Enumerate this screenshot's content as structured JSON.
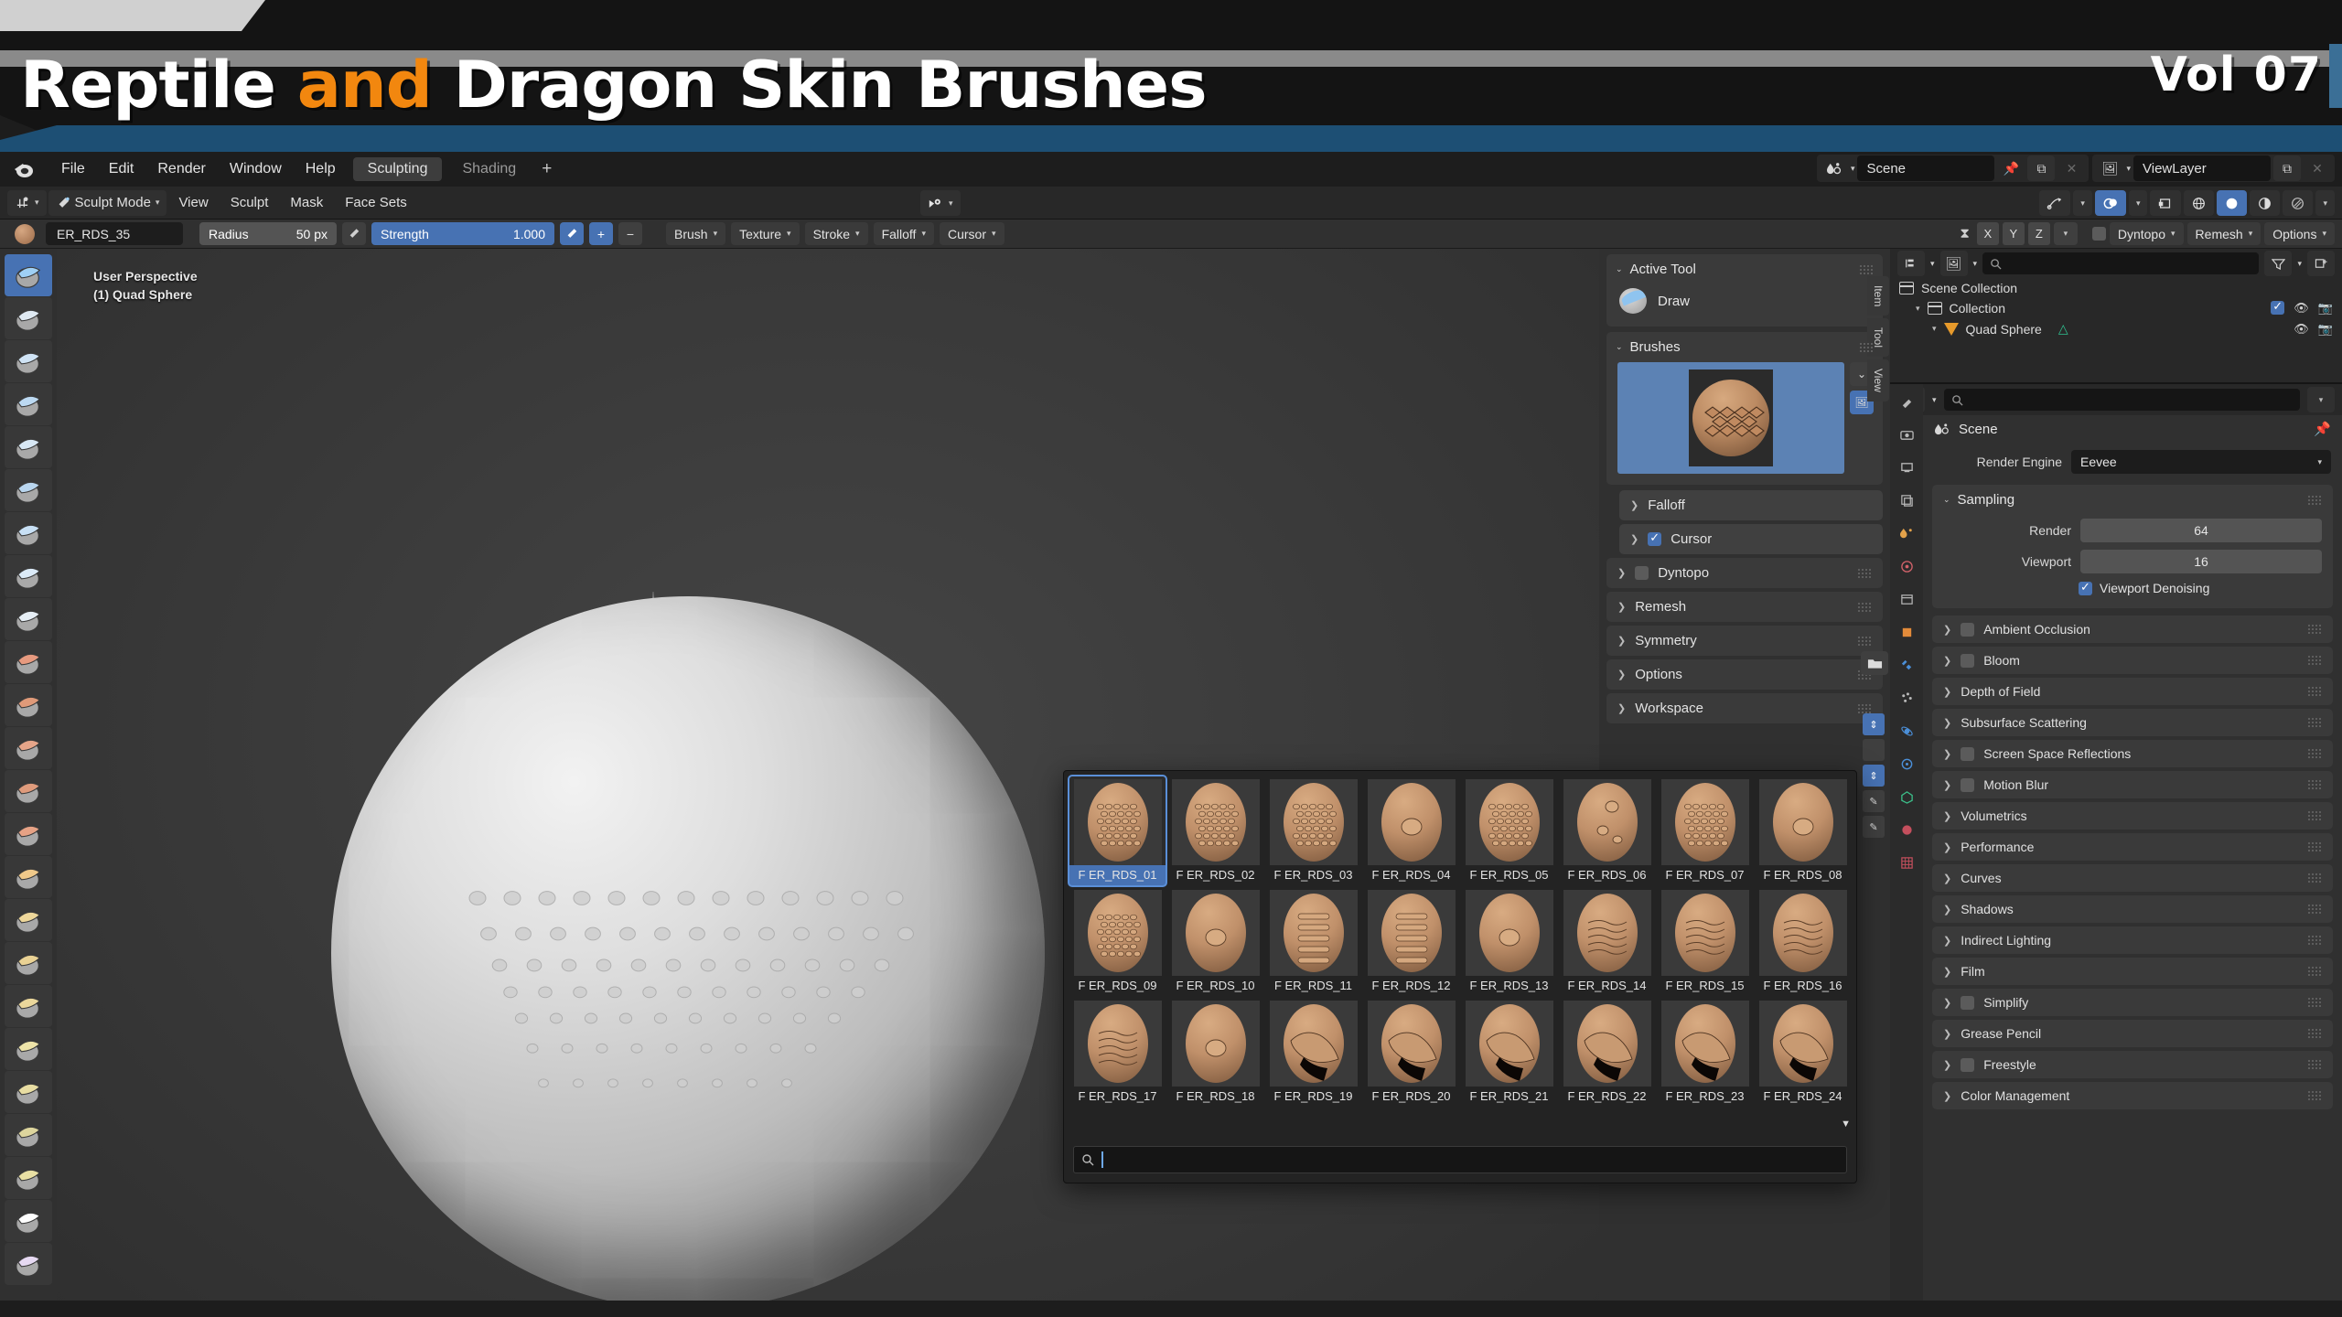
{
  "banner": {
    "title_part1": "Reptile ",
    "title_accent": "and",
    "title_part2": " Dragon Skin Brushes",
    "volume": "Vol 07",
    "accent_color": "#f2870f",
    "bar_color": "#1d4f74"
  },
  "topbar": {
    "logo_icon": "blender-logo-icon",
    "menus": [
      "File",
      "Edit",
      "Render",
      "Window",
      "Help"
    ],
    "workspaces": [
      {
        "label": "Sculpting",
        "active": true
      },
      {
        "label": "Shading",
        "active": false
      }
    ],
    "add_workspace": "+",
    "scene_name": "Scene",
    "view_layer_name": "ViewLayer"
  },
  "viewport_header": {
    "mode": "Sculpt Mode",
    "menus": [
      "View",
      "Sculpt",
      "Mask",
      "Face Sets"
    ],
    "shading_icons": [
      "wireframe-icon",
      "solid-icon",
      "material-preview-icon",
      "rendered-icon"
    ]
  },
  "tool_settings": {
    "brush_name": "ER_RDS_35",
    "radius_label": "Radius",
    "radius_value": "50 px",
    "strength_label": "Strength",
    "strength_value": "1.000",
    "plus_label": "+",
    "minus_label": "−",
    "dropdowns": [
      "Brush",
      "Texture",
      "Stroke",
      "Falloff",
      "Cursor"
    ],
    "symmetry_axes": [
      "X",
      "Y",
      "Z"
    ],
    "right_dropdowns": [
      "Dyntopo",
      "Remesh",
      "Options"
    ]
  },
  "viewport": {
    "overlay_line1": "User Perspective",
    "overlay_line2": "(1) Quad Sphere"
  },
  "sidebar": {
    "tabs": [
      "Item",
      "Tool",
      "View"
    ],
    "active_tool": {
      "header": "Active Tool",
      "tool_label": "Draw"
    },
    "brushes": {
      "header": "Brushes"
    },
    "rows": [
      {
        "label": "Falloff",
        "sub": true,
        "checkbox": null
      },
      {
        "label": "Cursor",
        "sub": true,
        "checkbox": true
      },
      {
        "label": "Dyntopo",
        "sub": false,
        "checkbox": false
      },
      {
        "label": "Remesh",
        "sub": false,
        "checkbox": null
      },
      {
        "label": "Symmetry",
        "sub": false,
        "checkbox": null
      },
      {
        "label": "Options",
        "sub": false,
        "checkbox": null
      },
      {
        "label": "Workspace",
        "sub": false,
        "checkbox": null
      }
    ]
  },
  "outliner": {
    "rows": [
      {
        "label": "Scene Collection",
        "depth": 0
      },
      {
        "label": "Collection",
        "depth": 1
      },
      {
        "label": "Quad Sphere",
        "depth": 2
      }
    ]
  },
  "properties": {
    "scene_label": "Scene",
    "render_engine_label": "Render Engine",
    "render_engine_value": "Eevee",
    "sampling": {
      "header": "Sampling",
      "render_label": "Render",
      "render_value": "64",
      "viewport_label": "Viewport",
      "viewport_value": "16",
      "denoise_label": "Viewport Denoising",
      "denoise_checked": true
    },
    "sections": [
      {
        "label": "Ambient Occlusion",
        "checkbox": false
      },
      {
        "label": "Bloom",
        "checkbox": false
      },
      {
        "label": "Depth of Field",
        "checkbox": null
      },
      {
        "label": "Subsurface Scattering",
        "checkbox": null
      },
      {
        "label": "Screen Space Reflections",
        "checkbox": false
      },
      {
        "label": "Motion Blur",
        "checkbox": false
      },
      {
        "label": "Volumetrics",
        "checkbox": null
      },
      {
        "label": "Performance",
        "checkbox": null
      },
      {
        "label": "Curves",
        "checkbox": null
      },
      {
        "label": "Shadows",
        "checkbox": null
      },
      {
        "label": "Indirect Lighting",
        "checkbox": null
      },
      {
        "label": "Film",
        "checkbox": null
      },
      {
        "label": "Simplify",
        "checkbox": false
      },
      {
        "label": "Grease Pencil",
        "checkbox": null
      },
      {
        "label": "Freestyle",
        "checkbox": false
      },
      {
        "label": "Color Management",
        "checkbox": null
      }
    ]
  },
  "brush_popup": {
    "search_placeholder": "",
    "selected_index": 0,
    "scroll_arrow": "▼",
    "items": [
      "F ER_RDS_01",
      "F ER_RDS_02",
      "F ER_RDS_03",
      "F ER_RDS_04",
      "F ER_RDS_05",
      "F ER_RDS_06",
      "F ER_RDS_07",
      "F ER_RDS_08",
      "F ER_RDS_09",
      "F ER_RDS_10",
      "F ER_RDS_11",
      "F ER_RDS_12",
      "F ER_RDS_13",
      "F ER_RDS_14",
      "F ER_RDS_15",
      "F ER_RDS_16",
      "F ER_RDS_17",
      "F ER_RDS_18",
      "F ER_RDS_19",
      "F ER_RDS_20",
      "F ER_RDS_21",
      "F ER_RDS_22",
      "F ER_RDS_23",
      "F ER_RDS_24"
    ]
  }
}
